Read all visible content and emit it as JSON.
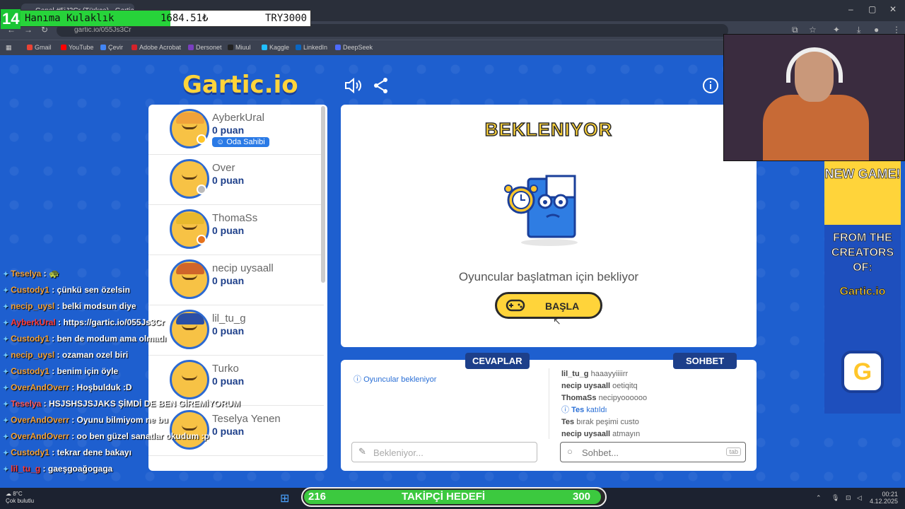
{
  "browser": {
    "tab_title": "Genel #5iJ3Cr (Türkçe) - Gartic",
    "url": "gartic.io/055Js3Cr",
    "bookmarks": [
      "Gmail",
      "YouTube",
      "Çevir",
      "Adobe Acrobat",
      "Dersonet",
      "Miuul",
      "Kaggle",
      "LinkedIn",
      "DeepSeek"
    ]
  },
  "overlay": {
    "k_label": "14",
    "item": "Hanıma Kulaklık",
    "amount": "1684.51₺",
    "target": "TRY3000"
  },
  "players": [
    {
      "name": "AyberkUral",
      "score": "0 puan",
      "badge": "Oda Sahibi",
      "dot": "#ffc62a",
      "hair": "#f0a23a"
    },
    {
      "name": "Over",
      "score": "0 puan",
      "badge": "",
      "dot": "#bbbbbb",
      "hair": "#f7c245"
    },
    {
      "name": "ThomaSs",
      "score": "0 puan",
      "badge": "",
      "dot": "#e5731d",
      "hair": "#e8b82d"
    },
    {
      "name": "necip uysaall",
      "score": "0 puan",
      "badge": "",
      "dot": "",
      "hair": "#d0652a"
    },
    {
      "name": "lil_tu_g",
      "score": "0 puan",
      "badge": "",
      "dot": "",
      "hair": "#2b4fa6"
    },
    {
      "name": "Turko",
      "score": "0 puan",
      "badge": "",
      "dot": "",
      "hair": "#f7c245"
    },
    {
      "name": "Teselya Yenen",
      "score": "0 puan",
      "badge": "",
      "dot": "",
      "hair": "#f7c245"
    }
  ],
  "main": {
    "logo": "Gartic.io",
    "status": "BEKLENIYOR",
    "waiting_text": "Oyuncular başlatman için bekliyor",
    "start_label": "BAŞLA"
  },
  "answers": {
    "tag": "CEVAPLAR",
    "info": "Oyuncular bekleniyor",
    "placeholder": "Bekleniyor..."
  },
  "chat": {
    "tag": "SOHBET",
    "placeholder": "Sohbet...",
    "tab_key": "tab",
    "messages": [
      {
        "user": "lil_tu_g",
        "text": "haaayyiiiirr"
      },
      {
        "user": "necip uysaall",
        "text": "oetiqitq"
      },
      {
        "user": "ThomaSs",
        "text": "necipyoooooo"
      },
      {
        "user": "Tes",
        "text": "katıldı",
        "system": true
      },
      {
        "user": "Tes",
        "text": "bırak peşimi custo"
      },
      {
        "user": "necip uysaall",
        "text": "atmayın"
      }
    ]
  },
  "ad": {
    "top": "NEW GAME!",
    "line1": "FROM THE",
    "line2": "CREATORS",
    "line3": "OF:",
    "brand": "Gartic.io",
    "g": "G"
  },
  "stream_chat": [
    {
      "user": "Teselya",
      "text": ": 🐢",
      "color": "#f2a23a"
    },
    {
      "user": "Custody1",
      "text": ": çünkü sen özelsin",
      "color": "#f2a23a"
    },
    {
      "user": "necip_uysl",
      "text": ": belki modsun diye",
      "color": "#f2a23a"
    },
    {
      "user": "AyberkUral",
      "text": ": https://gartic.io/055Js3Cr",
      "color": "#ff3b3b"
    },
    {
      "user": "Custody1",
      "text": ": ben de modum ama olmadı",
      "color": "#f2a23a"
    },
    {
      "user": "necip_uysl",
      "text": ": ozaman ozel biri",
      "color": "#f2a23a"
    },
    {
      "user": "Custody1",
      "text": ": benim için öyle",
      "color": "#f2a23a"
    },
    {
      "user": "OverAndOverr",
      "text": ": Hoşbulduk :D",
      "color": "#f2a23a"
    },
    {
      "user": "Teselya",
      "text": ": HSJSHSJSJAKS ŞİMDİ DE BEN GİREMİYORUM",
      "color": "#ff5a5a"
    },
    {
      "user": "OverAndOverr",
      "text": ": Oyunu bilmiyom ne bu",
      "color": "#f2a23a"
    },
    {
      "user": "OverAndOverr",
      "text": ": oo ben güzel sanatlar okudum :p",
      "color": "#f2a23a"
    },
    {
      "user": "Custody1",
      "text": ": tekrar dene bakayı",
      "color": "#f2a23a"
    },
    {
      "user": "lil_tu_g",
      "text": ": gaeşgoağogaga",
      "color": "#ff3b3b"
    }
  ],
  "taskbar": {
    "temp": "8°C",
    "weather": "Çok bulutlu",
    "goal_count": "216",
    "goal_label": "TAKİPÇİ HEDEFİ",
    "goal_target": "300",
    "time": "00:21",
    "date": "4.12.2025"
  }
}
